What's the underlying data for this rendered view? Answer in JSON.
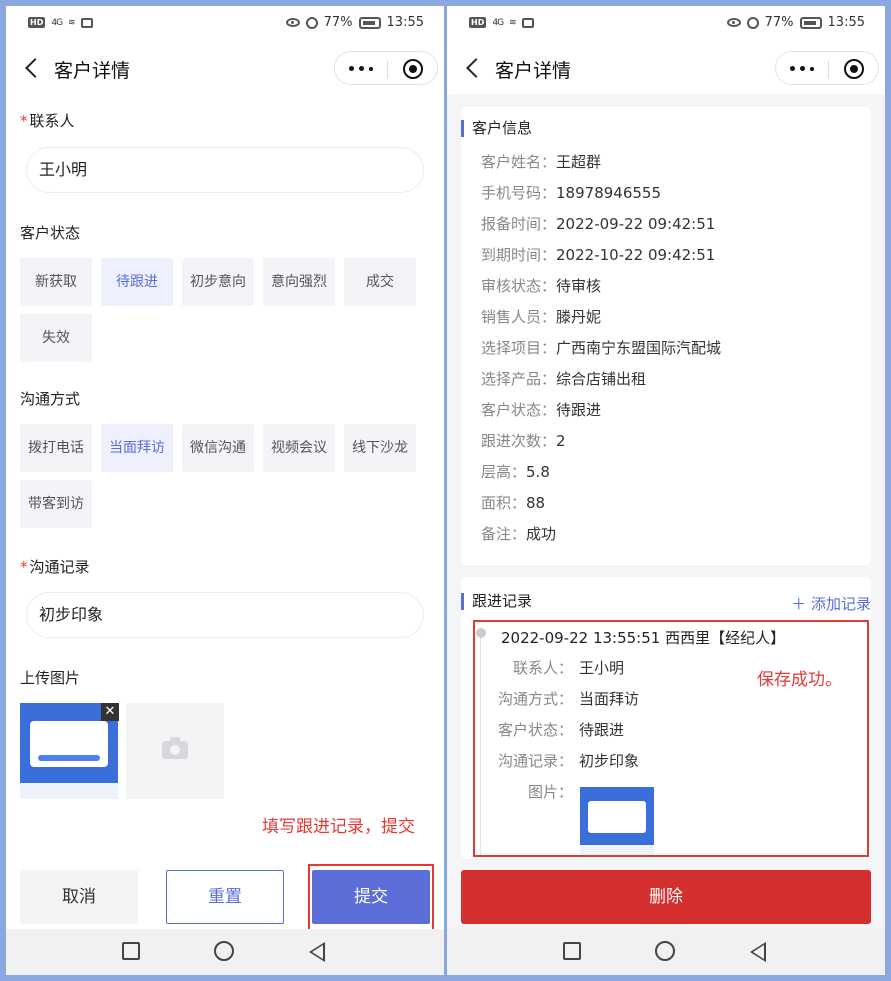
{
  "status_bar": {
    "battery": "77%",
    "time": "13:55",
    "network": "4G"
  },
  "header": {
    "title": "客户详情"
  },
  "form": {
    "contact": {
      "label": "联系人",
      "value": "王小明"
    },
    "customer_status": {
      "label": "客户状态",
      "options": [
        "新获取",
        "待跟进",
        "初步意向",
        "意向强烈",
        "成交",
        "失效"
      ],
      "selected": "待跟进"
    },
    "comm_method": {
      "label": "沟通方式",
      "options": [
        "拨打电话",
        "当面拜访",
        "微信沟通",
        "视频会议",
        "线下沙龙",
        "带客到访"
      ],
      "selected": "当面拜访"
    },
    "record": {
      "label": "沟通记录",
      "value": "初步印象"
    },
    "upload": {
      "label": "上传图片",
      "close": "✕"
    }
  },
  "annotations": {
    "left": "填写跟进记录，提交",
    "right": "保存成功。"
  },
  "buttons": {
    "cancel": "取消",
    "reset": "重置",
    "submit": "提交",
    "delete": "删除"
  },
  "customer_info": {
    "title": "客户信息",
    "rows": [
      {
        "key": "客户姓名：",
        "value": "王超群"
      },
      {
        "key": "手机号码：",
        "value": "18978946555"
      },
      {
        "key": "报备时间：",
        "value": "2022-09-22 09:42:51"
      },
      {
        "key": "到期时间：",
        "value": "2022-10-22 09:42:51"
      },
      {
        "key": "审核状态：",
        "value": "待审核"
      },
      {
        "key": "销售人员：",
        "value": "滕丹妮"
      },
      {
        "key": "选择项目：",
        "value": "广西南宁东盟国际汽配城"
      },
      {
        "key": "选择产品：",
        "value": "综合店铺出租"
      },
      {
        "key": "客户状态：",
        "value": "待跟进"
      },
      {
        "key": "跟进次数：",
        "value": "2"
      },
      {
        "key": "层高：",
        "value": "5.8"
      },
      {
        "key": "面积：",
        "value": "88"
      },
      {
        "key": "备注：",
        "value": "成功"
      }
    ]
  },
  "follow_up": {
    "title": "跟进记录",
    "add_label": "＋ 添加记录",
    "record": {
      "header": "2022-09-22 13:55:51 西西里【经纪人】",
      "rows": [
        {
          "key": "联系人：",
          "value": "王小明"
        },
        {
          "key": "沟通方式：",
          "value": "当面拜访"
        },
        {
          "key": "客户状态：",
          "value": "待跟进"
        },
        {
          "key": "沟通记录：",
          "value": "初步印象"
        },
        {
          "key": "图片：",
          "value": ""
        }
      ]
    }
  },
  "colors": {
    "accent": "#5c6fd8",
    "danger": "#d32f2f",
    "annotation": "#e53935"
  }
}
